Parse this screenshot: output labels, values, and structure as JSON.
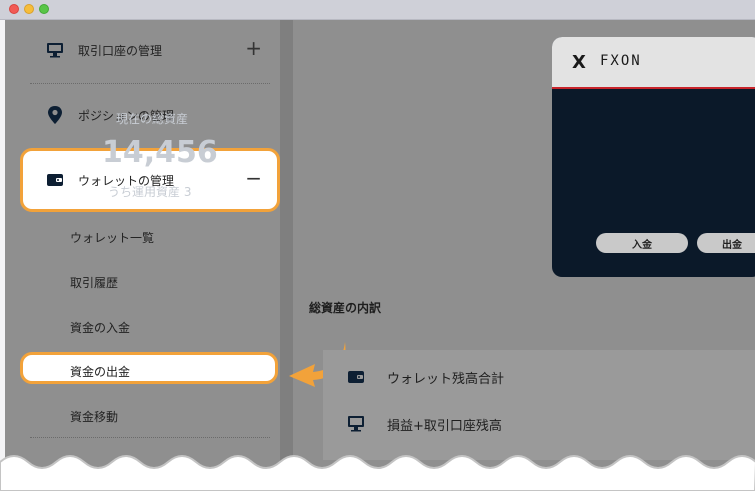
{
  "window": {
    "controls": [
      "close",
      "minimize",
      "maximize"
    ]
  },
  "sidebar": {
    "items": [
      {
        "label": "取引口座の管理",
        "icon": "monitor-icon",
        "toggle": "+"
      },
      {
        "label": "ポジションの管理",
        "icon": "location-pin-icon"
      },
      {
        "label": "ウォレットの管理",
        "icon": "wallet-icon",
        "toggle": "−"
      }
    ],
    "wallet_sub": [
      "ウォレット一覧",
      "取引履歴",
      "資金の入金",
      "資金の出金",
      "資金移動"
    ]
  },
  "card": {
    "logo": "FXON",
    "total_label": "現在の総資産",
    "total_amount": "14,456",
    "sub_label": "うち運用資産 3",
    "deposit_button": "入金",
    "withdraw_button": "出金"
  },
  "breakdown": {
    "title": "総資産の内訳",
    "rows": [
      {
        "label": "ウォレット残高合計",
        "icon": "wallet-icon"
      },
      {
        "label": "損益+取引口座残高",
        "icon": "monitor-icon"
      }
    ]
  },
  "colors": {
    "highlight": "#f2a23a",
    "card_bg": "#0b1929",
    "brand_red": "#c8242b"
  }
}
